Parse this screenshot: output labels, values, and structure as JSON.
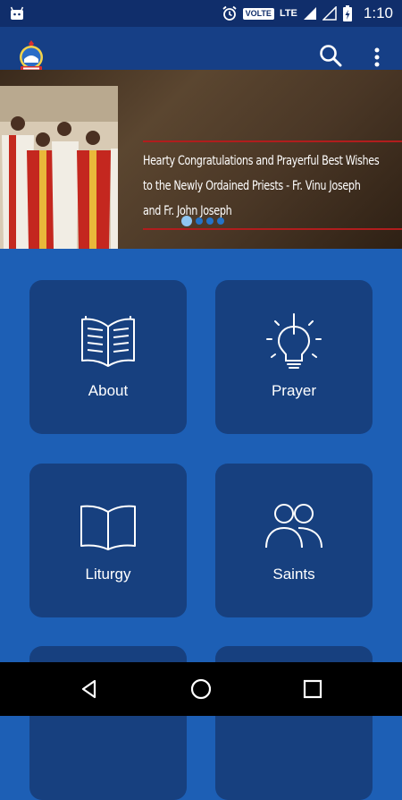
{
  "status_bar": {
    "network_label": "VOLTE",
    "lte_label": "LTE",
    "time": "1:10"
  },
  "app_bar": {
    "logo_icon": "church-emblem-icon",
    "search_icon": "search-icon",
    "more_icon": "more-vert-icon"
  },
  "banner": {
    "headline_line1": "Hearty Congratulations and Prayerful Best Wishes",
    "headline_line2": "to the Newly Ordained Priests - Fr. Vinu Joseph",
    "headline_line3": "and Fr. John Joseph",
    "slide_count": 4,
    "active_slide": 1
  },
  "tiles": [
    {
      "label": "About",
      "icon": "open-book-icon"
    },
    {
      "label": "Prayer",
      "icon": "lightbulb-icon"
    },
    {
      "label": "Liturgy",
      "icon": "book-icon"
    },
    {
      "label": "Saints",
      "icon": "people-icon"
    }
  ],
  "colors": {
    "background": "#1d5fb5",
    "tile": "#17407f",
    "app_bar": "#163f86",
    "status_bar": "#102e6b",
    "accent_line": "#b11d1d"
  }
}
